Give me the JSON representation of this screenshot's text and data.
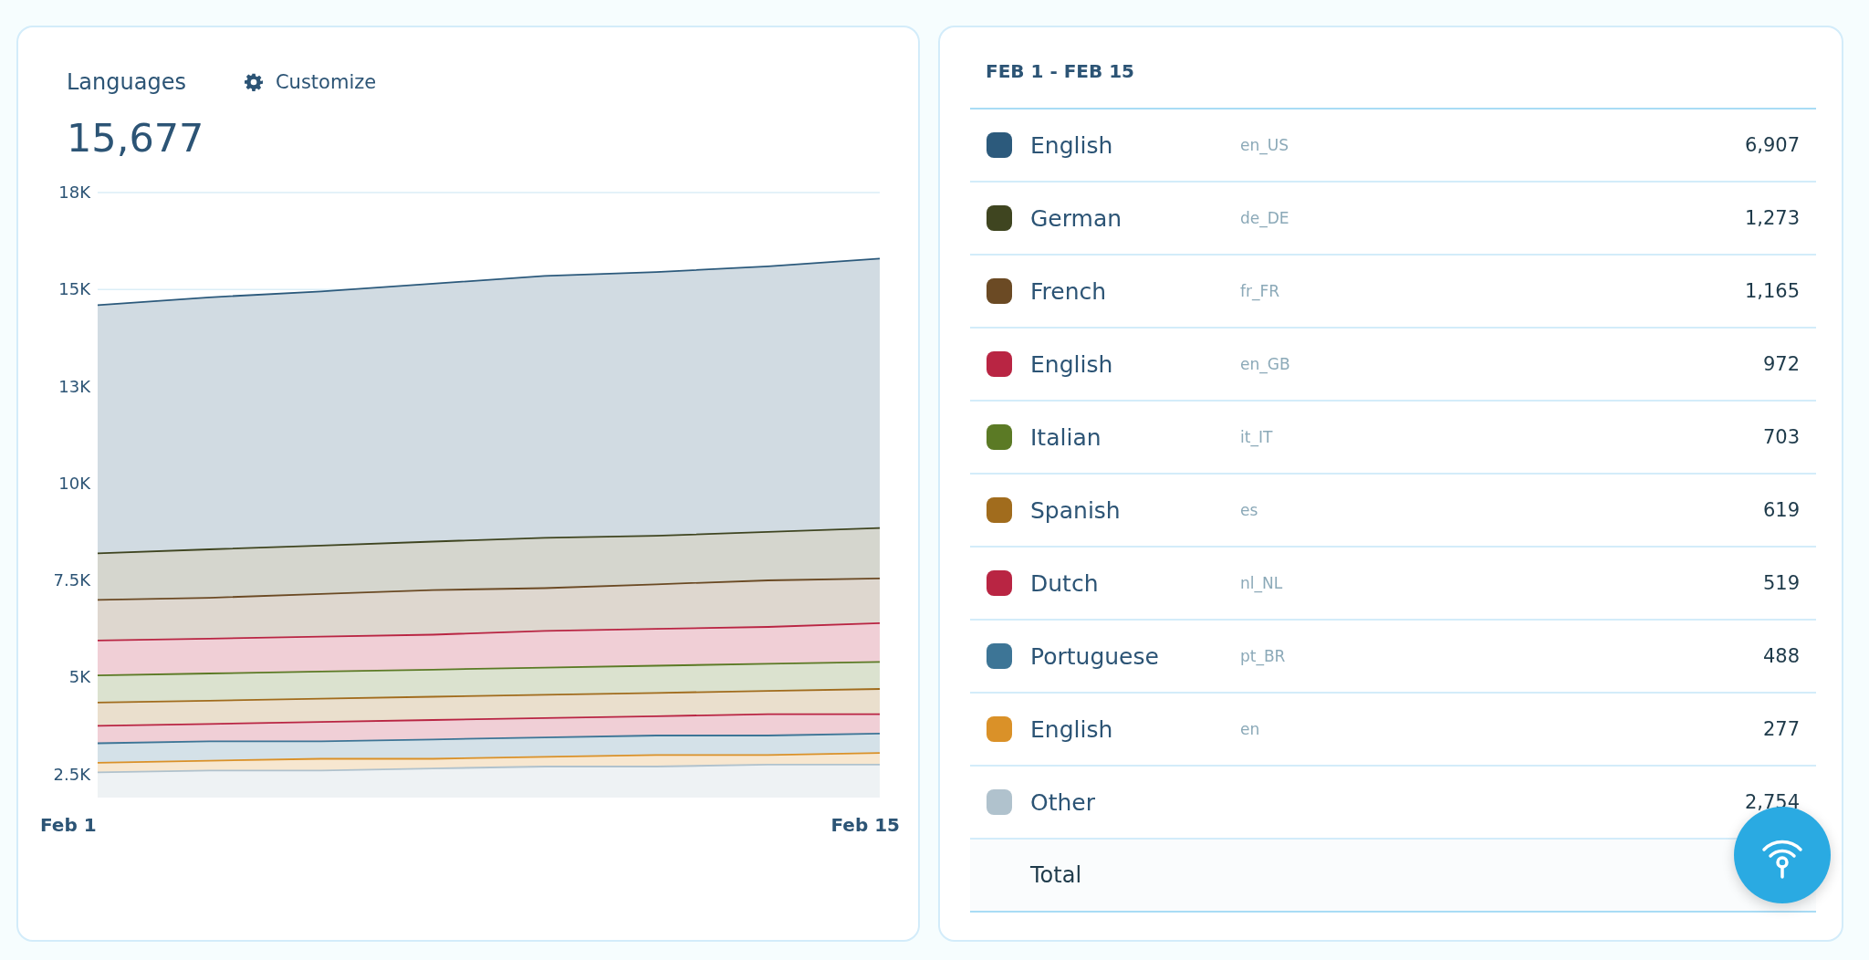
{
  "chart_card": {
    "title": "Languages",
    "customize_label": "Customize",
    "total": "15,677",
    "chart_data": {
      "type": "area",
      "stacked": false,
      "categories": [
        "Feb 1",
        null,
        null,
        null,
        null,
        null,
        null,
        "Feb 15"
      ],
      "ylim": [
        1900,
        17500
      ],
      "yticks": [
        {
          "value": 2500,
          "label": "2.5K"
        },
        {
          "value": 5000,
          "label": "5K"
        },
        {
          "value": 7500,
          "label": "7.5K"
        },
        {
          "value": 10000,
          "label": "10K"
        },
        {
          "value": 12500,
          "label": "13K"
        },
        {
          "value": 15000,
          "label": "15K"
        },
        {
          "value": 17500,
          "label": "18K"
        }
      ],
      "series": [
        {
          "color": "#b0c2cd",
          "values": [
            2550,
            2600,
            2600,
            2650,
            2700,
            2700,
            2750,
            2750
          ]
        },
        {
          "color": "#da9128",
          "values": [
            2800,
            2850,
            2900,
            2900,
            2950,
            3000,
            3000,
            3050
          ]
        },
        {
          "color": "#3d7596",
          "values": [
            3300,
            3350,
            3350,
            3400,
            3450,
            3500,
            3500,
            3550
          ]
        },
        {
          "color": "#b92543",
          "values": [
            3750,
            3800,
            3850,
            3900,
            3950,
            4000,
            4050,
            4050
          ]
        },
        {
          "color": "#a16c1d",
          "values": [
            4350,
            4400,
            4450,
            4500,
            4550,
            4600,
            4650,
            4700
          ]
        },
        {
          "color": "#5b7a25",
          "values": [
            5050,
            5100,
            5150,
            5200,
            5250,
            5300,
            5350,
            5400
          ]
        },
        {
          "color": "#b92543",
          "values": [
            5950,
            6000,
            6050,
            6100,
            6200,
            6250,
            6300,
            6400
          ]
        },
        {
          "color": "#6b4a24",
          "values": [
            7000,
            7050,
            7150,
            7250,
            7300,
            7400,
            7500,
            7550
          ]
        },
        {
          "color": "#3f4520",
          "values": [
            8200,
            8300,
            8400,
            8500,
            8600,
            8650,
            8750,
            8850
          ]
        },
        {
          "color": "#2c5a7c",
          "values": [
            14600,
            14800,
            14950,
            15150,
            15350,
            15450,
            15600,
            15800
          ]
        }
      ]
    }
  },
  "table_card": {
    "period": "FEB 1 - FEB 15",
    "rows": [
      {
        "color": "#2c5a7c",
        "name": "English",
        "code": "en_US",
        "count": "6,907"
      },
      {
        "color": "#3f4520",
        "name": "German",
        "code": "de_DE",
        "count": "1,273"
      },
      {
        "color": "#6b4a24",
        "name": "French",
        "code": "fr_FR",
        "count": "1,165"
      },
      {
        "color": "#b92543",
        "name": "English",
        "code": "en_GB",
        "count": "972"
      },
      {
        "color": "#5b7a25",
        "name": "Italian",
        "code": "it_IT",
        "count": "703"
      },
      {
        "color": "#a16c1d",
        "name": "Spanish",
        "code": "es",
        "count": "619"
      },
      {
        "color": "#b92543",
        "name": "Dutch",
        "code": "nl_NL",
        "count": "519"
      },
      {
        "color": "#3d7596",
        "name": "Portuguese",
        "code": "pt_BR",
        "count": "488"
      },
      {
        "color": "#da9128",
        "name": "English",
        "code": "en",
        "count": "277"
      },
      {
        "color": "#b0c2cd",
        "name": "Other",
        "count": "2,754"
      }
    ],
    "total_label": "Total"
  }
}
